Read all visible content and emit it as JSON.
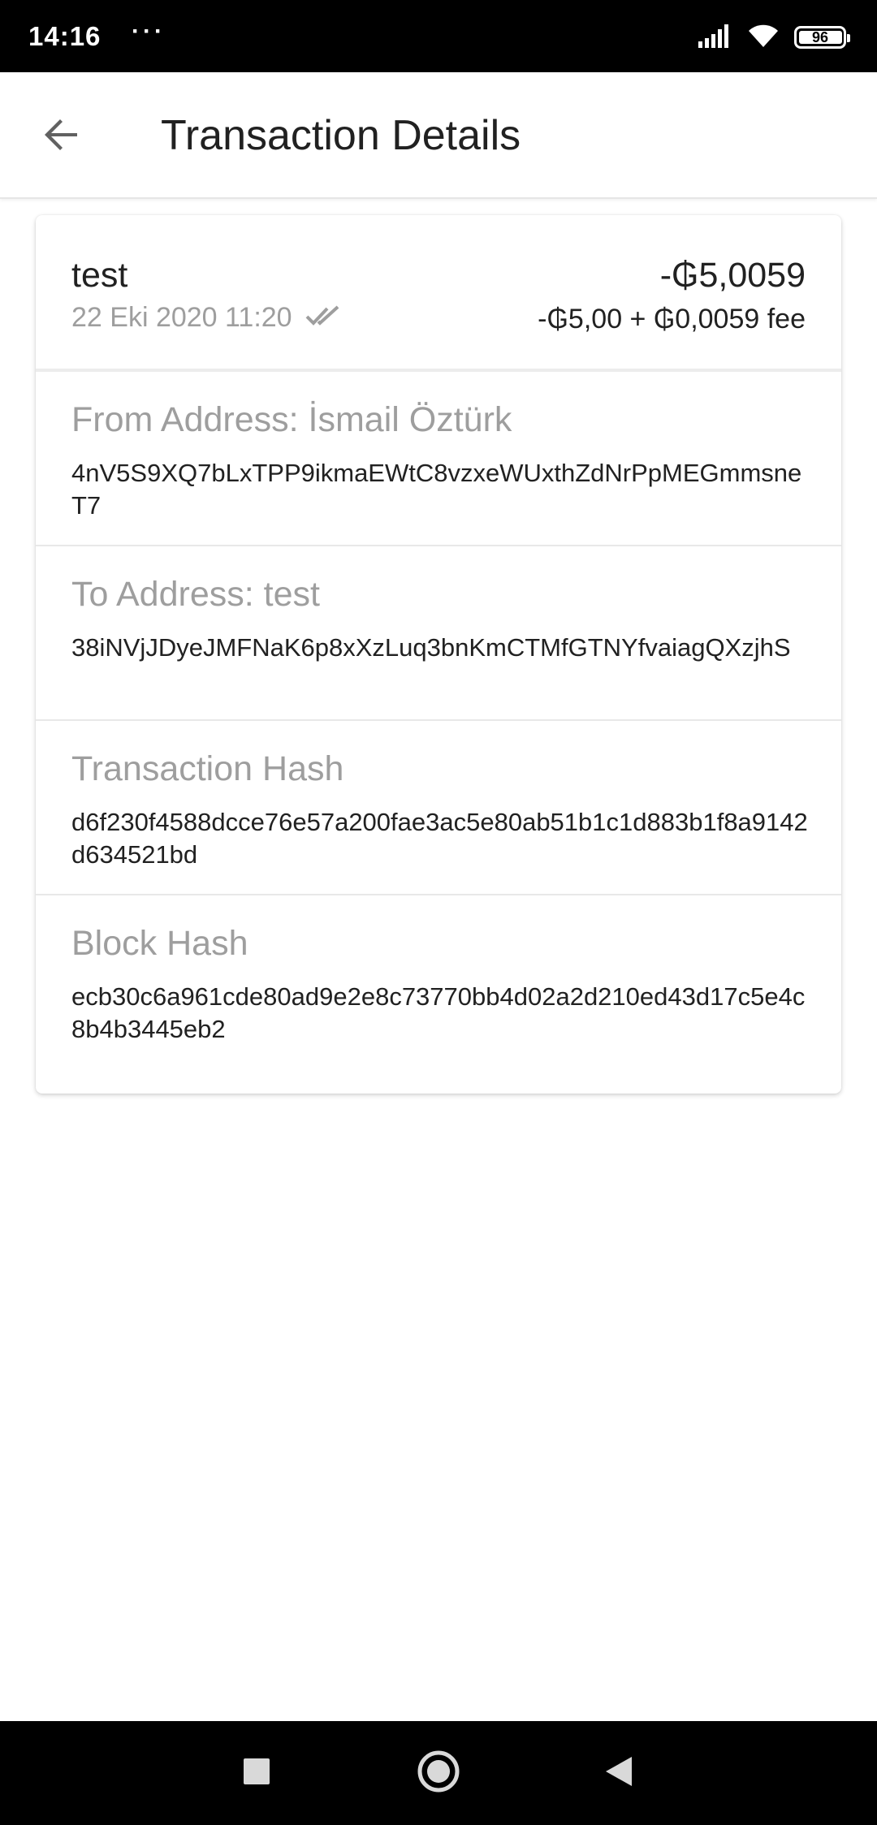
{
  "status_bar": {
    "time": "14:16",
    "dots": "···",
    "battery": "96",
    "icons": [
      "signal-icon",
      "wifi-icon",
      "battery-icon"
    ]
  },
  "app_bar": {
    "title": "Transaction Details",
    "back_icon": "arrow-back-icon"
  },
  "transaction": {
    "name": "test",
    "date": "22 Eki 2020 11:20",
    "status_icon": "double-check-icon",
    "amount": "-₲5,0059",
    "breakdown": "-₲5,00 + ₲0,0059 fee"
  },
  "sections": [
    {
      "label": "From Address: İsmail Öztürk",
      "value": "4nV5S9XQ7bLxTPP9ikmaEWtC8vzxeWUxthZdNrPpMEGmmsneT7"
    },
    {
      "label": "To Address: test",
      "value": "38iNVjJDyeJMFNaK6p8xXzLuq3bnKmCTMfGTNYfvaiagQXzjhS"
    },
    {
      "label": "Transaction Hash",
      "value": "d6f230f4588dcce76e57a200fae3ac5e80ab51b1c1d883b1f8a9142d634521bd"
    },
    {
      "label": "Block Hash",
      "value": "ecb30c6a961cde80ad9e2e8c73770bb4d02a2d210ed43d17c5e4c8b4b3445eb2"
    }
  ],
  "nav_bar": {
    "buttons": [
      "recents-square-icon",
      "home-circle-icon",
      "back-triangle-icon"
    ]
  },
  "colors": {
    "text_primary": "#212121",
    "text_secondary": "#9e9e9e",
    "background": "#ffffff",
    "system_bars": "#000000"
  }
}
